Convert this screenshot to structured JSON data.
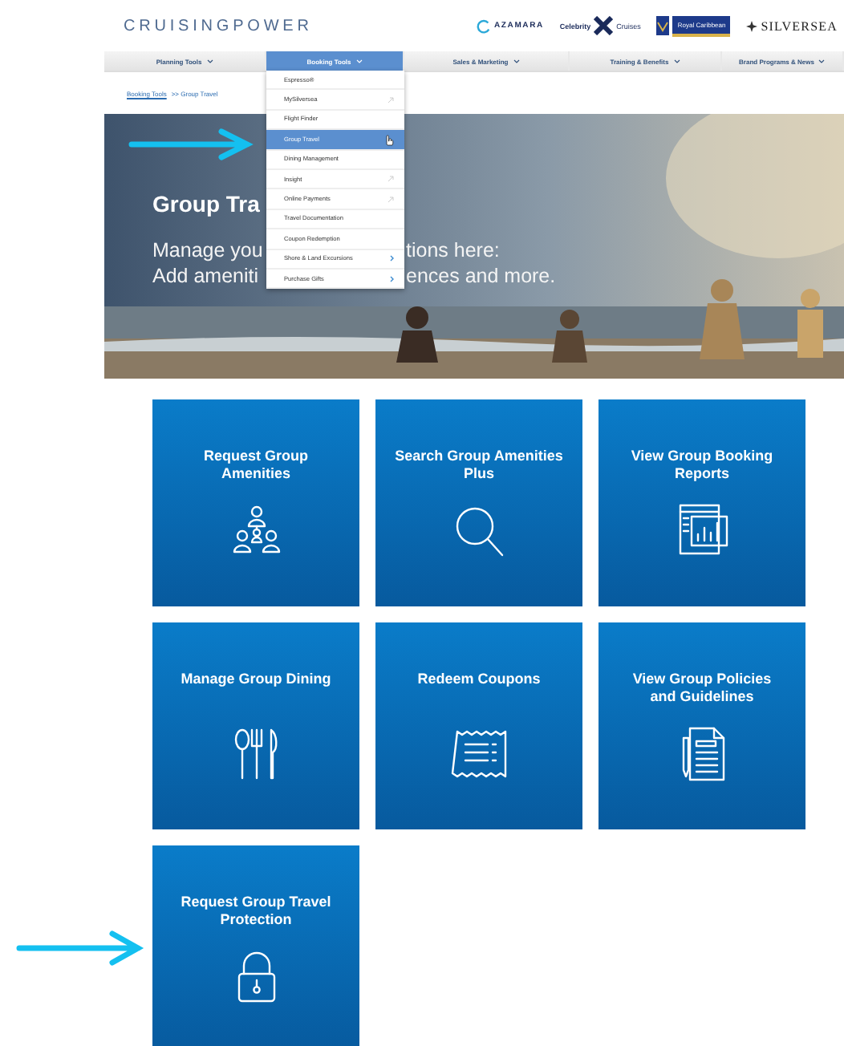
{
  "logo": "CRUISINGPOWER",
  "brands": [
    {
      "kind": "ring",
      "label": "AZAMARA"
    },
    {
      "kind": "cross",
      "label": "Celebrity",
      "label_2": "Cruises"
    },
    {
      "kind": "boxed",
      "label": "Royal Caribbean"
    },
    {
      "kind": "emblem",
      "label": "SILVERSEA"
    }
  ],
  "nav": [
    {
      "label": "Planning Tools",
      "selected": false
    },
    {
      "label": "Booking Tools",
      "selected": true
    },
    {
      "label": "Sales & Marketing",
      "selected": false
    },
    {
      "label": "Training & Benefits",
      "selected": false
    },
    {
      "label": "Brand Programs & News",
      "selected": false
    }
  ],
  "dropdown": [
    {
      "label": "Espresso®",
      "kind": "plain",
      "selected": false
    },
    {
      "label": "MySilversea",
      "kind": "external",
      "selected": false
    },
    {
      "label": "Flight Finder",
      "kind": "plain",
      "selected": false
    },
    {
      "label": "Group Travel",
      "kind": "plain",
      "selected": true
    },
    {
      "label": "Dining Management",
      "kind": "plain",
      "selected": false
    },
    {
      "label": "Insight",
      "kind": "external",
      "selected": false
    },
    {
      "label": "Online Payments",
      "kind": "external",
      "selected": false
    },
    {
      "label": "Travel Documentation",
      "kind": "plain",
      "selected": false
    },
    {
      "label": "Coupon Redemption",
      "kind": "plain",
      "selected": false
    },
    {
      "label": "Shore & Land Excursions",
      "kind": "submenu",
      "selected": false
    },
    {
      "label": "Purchase Gifts",
      "kind": "submenu",
      "selected": false
    }
  ],
  "breadcrumb": {
    "link": "Booking Tools",
    "current": ">> Group Travel"
  },
  "hero": {
    "title": "Group Tra",
    "lines": [
      {
        "left": "Manage you",
        "right": "tions here:"
      },
      {
        "left": "Add ameniti",
        "right": "ences and more."
      }
    ]
  },
  "tiles": [
    {
      "title": "Request Group Amenities",
      "kind": "people"
    },
    {
      "title": "Search Group Amenities Plus",
      "kind": "search"
    },
    {
      "title": "View Group Booking Reports",
      "kind": "report"
    },
    {
      "title": "Manage Group Dining",
      "kind": "dining"
    },
    {
      "title": "Redeem Coupons",
      "kind": "coupon"
    },
    {
      "title": "View Group Policies and Guidelines",
      "kind": "document"
    },
    {
      "title": "Request Group Travel Protection",
      "kind": "lock"
    }
  ]
}
